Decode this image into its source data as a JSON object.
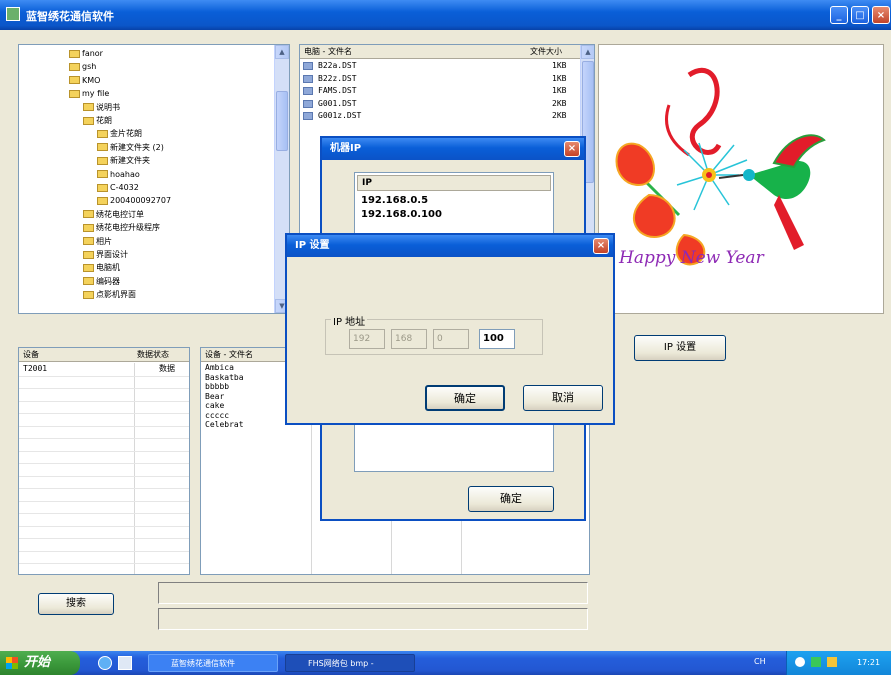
{
  "window": {
    "title": "蓝智绣花通信软件",
    "minimize_icon": "_",
    "maximize_icon": "□",
    "close_icon": "×"
  },
  "folder_tree": {
    "items": [
      {
        "label": "fanor",
        "indent": 0
      },
      {
        "label": "gsh",
        "indent": 0
      },
      {
        "label": "KMO",
        "indent": 0
      },
      {
        "label": "my file",
        "indent": 0
      },
      {
        "label": "说明书",
        "indent": 1
      },
      {
        "label": "花朗",
        "indent": 1
      },
      {
        "label": "金片花朗",
        "indent": 2
      },
      {
        "label": "新建文件夹 (2)",
        "indent": 2
      },
      {
        "label": "新建文件夹",
        "indent": 2
      },
      {
        "label": "hoahao",
        "indent": 2
      },
      {
        "label": "C-4032",
        "indent": 2
      },
      {
        "label": "200400092707",
        "indent": 2
      },
      {
        "label": "绣花电控订单",
        "indent": 1
      },
      {
        "label": "绣花电控升级程序",
        "indent": 1
      },
      {
        "label": "相片",
        "indent": 1
      },
      {
        "label": "界面设计",
        "indent": 1
      },
      {
        "label": "电脑机",
        "indent": 1
      },
      {
        "label": "编码器",
        "indent": 1
      },
      {
        "label": "点影机界面",
        "indent": 1
      }
    ]
  },
  "file_list": {
    "col_name": "电脑 - 文件名",
    "col_size": "文件大小",
    "rows": [
      {
        "name": "B22a.DST",
        "size": "1KB"
      },
      {
        "name": "B22z.DST",
        "size": "1KB"
      },
      {
        "name": "FAMS.DST",
        "size": "1KB"
      },
      {
        "name": "G001.DST",
        "size": "2KB"
      },
      {
        "name": "G001z.DST",
        "size": "2KB"
      }
    ]
  },
  "device_list": {
    "col_device": "设备",
    "col_status": "数据状态",
    "rows": [
      {
        "device": "T2001",
        "status": "数据"
      }
    ]
  },
  "device_files": {
    "col_name": "设备 - 文件名",
    "rows": [
      "Ambica",
      "Baskatba",
      "bbbbb",
      "Bear",
      "cake",
      "ccccc",
      "Celebrat"
    ]
  },
  "preview": {
    "caption": "Happy New Year"
  },
  "buttons": {
    "ip_setting": "IP 设置",
    "search": "搜索"
  },
  "ip_list_dialog": {
    "title": "机器IP",
    "column": "IP",
    "ips": [
      "192.168.0.5",
      "192.168.0.100"
    ],
    "ok_label": "确定"
  },
  "ip_dialog": {
    "title": "IP 设置",
    "group_label": "IP 地址",
    "octets": [
      "192",
      "168",
      "0",
      "100"
    ],
    "ok_label": "确定",
    "cancel_label": "取消"
  },
  "taskbar": {
    "start_label": "开始",
    "tasks": [
      "蓝智绣花通信软件",
      "FHS网络包 bmp -"
    ],
    "tray_lang": "CH",
    "clock": "17:21"
  },
  "colors": {
    "titlebar": "#0a5fd8",
    "taskbar": "#245edb",
    "start": "#3c9a3c",
    "face": "#ece9d8"
  }
}
